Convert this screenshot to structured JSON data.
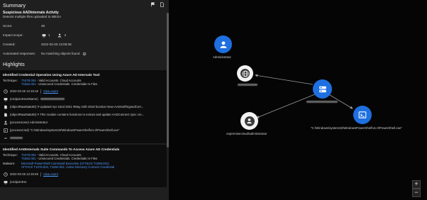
{
  "panel": {
    "title": "Summary",
    "alert_name": "Suspicious AADInternals Activity",
    "alert_sub": "Detects multiple files uploaded to MEGA",
    "score_label": "Score:",
    "score_value": "49",
    "impact_label": "Impact scope:",
    "impact_hosts": "1",
    "impact_users": "2",
    "created_label": "Created:",
    "created_value": "2022-03-25 13:08:38",
    "automated_label": "Automated responses:",
    "automated_value": "No matching objects found"
  },
  "highlights_title": "Highlights",
  "card1": {
    "title": "Identified Credential Operation Using Azure AD Internals Tool",
    "technique_label": "Technique:",
    "t1_id": "T1078.004",
    "t1_desc": " - Valid Accounts. Cloud Accounts",
    "t2_id": "T1552.001",
    "t2_desc": " - Unsecured Credentials. Credentials In Files",
    "ts": "2022-03-25 12:19:18",
    "view": "View event",
    "e1": "(endpointHostName)",
    "e2": "(objectRawDataStr) # Updated Apr 22nd 2021 #May 24th 2019 function New-AADSelfSignedCert...",
    "e3": "(objectRawDataStr) # This module contains functions to extract and update AADConnect sync cre...",
    "e4": "(processUser) Administrator",
    "e5": "(processCmd) \"C:\\Windows\\system32\\WindowsPowerShell\\v1.0\\PowerShell.exe\""
  },
  "card2": {
    "title": "Identified AADInternals Suite Commands To Access Azure AD Credentials",
    "technique_label": "Technique:",
    "t1_id": "T1078.004",
    "t1_desc": " - Valid Accounts. Cloud Accounts",
    "t2_id": "T1552.001",
    "t2_desc": " - Unsecured Credentials. Credentials In Files",
    "malware_label": "Malware:",
    "m1": "Microsoft PowerShell Command Execution (ATT&CK T1059.001)",
    "m2": "ATTACK T1078.004, T1552.001: Active Directory Connect Credential",
    "ts": "2022-03-25 12:19:49",
    "view": "View event",
    "e1": "(endpointHo"
  },
  "graph": {
    "admin_label": "Administrator",
    "onprem_label": "onpremisecloud\\administrator",
    "ps_label": "\"C:\\Windows\\system32\\WindowsPowerShell\\v1.0\\PowerShell.exe\"",
    "zoom_in": "+",
    "zoom_out": "−"
  },
  "colors": {
    "accent": "#1e6fe0",
    "link": "#4e9bff",
    "panel": "#1f1f1f"
  }
}
